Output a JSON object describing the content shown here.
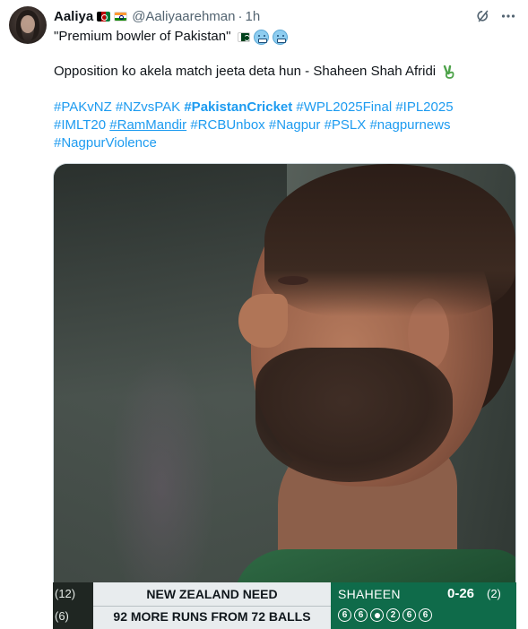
{
  "author": {
    "name": "Aaliya",
    "handle": "@Aaliyaarehman",
    "time": "1h",
    "separator": "·"
  },
  "icons": {
    "grok": "grok-icon",
    "more": "more-horizontal-icon",
    "flags": [
      "afghanistan-flag-icon",
      "india-flag-icon",
      "pakistan-flag-icon"
    ],
    "emoji": [
      "cold-face-emoji",
      "cold-face-emoji",
      "victory-hand-emoji"
    ]
  },
  "tweet": {
    "line1": "\"Premium bowler of Pakistan\"",
    "line2": "Opposition ko akela match jeeta deta hun - Shaheen Shah Afridi",
    "hashtags": [
      {
        "text": "#PAKvNZ",
        "style": "normal"
      },
      {
        "text": "#NZvsPAK",
        "style": "normal"
      },
      {
        "text": "#PakistanCricket",
        "style": "bold"
      },
      {
        "text": "#WPL2025Final",
        "style": "normal"
      },
      {
        "text": "#IPL2025",
        "style": "normal"
      },
      {
        "text": "#IMLT20",
        "style": "normal"
      },
      {
        "text": "#RamMandir",
        "style": "underline"
      },
      {
        "text": "#RCBUnbox",
        "style": "normal"
      },
      {
        "text": "#Nagpur",
        "style": "normal"
      },
      {
        "text": "#PSLX",
        "style": "normal"
      },
      {
        "text": "#nagpurnews",
        "style": "normal"
      },
      {
        "text": "#NagpurViolence",
        "style": "normal"
      }
    ]
  },
  "scorecard": {
    "left_top": "(12)",
    "left_bottom": "(6)",
    "need_top": "NEW ZEALAND NEED",
    "need_bottom": "92 MORE RUNS FROM 72 BALLS",
    "bowler": "SHAHEEN",
    "figures": "0-26",
    "overs": "(2)",
    "balls": [
      "6",
      "6",
      "•",
      "2",
      "6",
      "6"
    ]
  },
  "colors": {
    "link": "#1d9bf0",
    "secondary_text": "#536471",
    "score_green": "#0f6b4a",
    "score_light": "#e8ecee"
  }
}
